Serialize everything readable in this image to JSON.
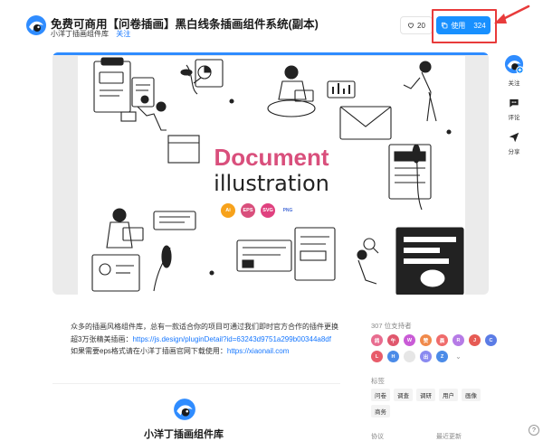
{
  "header": {
    "title": "免费可商用【问卷插画】黑白线条插画组件系统(副本)",
    "author": "小洋丁插画组件库",
    "follow_label": "关注",
    "like_count": "20",
    "use_label": "使用",
    "use_count": "324"
  },
  "preview": {
    "heading": "Document",
    "subheading": "illustration",
    "format_badges": [
      {
        "label": "Ai",
        "color": "#f7a21b"
      },
      {
        "label": "EPS",
        "color": "#d94f7c"
      },
      {
        "label": "SVG",
        "color": "#e0417f"
      },
      {
        "label": "PNG",
        "color": "#4a6fd8"
      }
    ]
  },
  "rail": {
    "follow_label": "关注",
    "comment_label": "评论",
    "share_label": "分享"
  },
  "description": {
    "line1": "众多的插画风格组件库，总有一款适合你的项目可通过我们即时官方合作的插件更换超3万张精美插画：",
    "link1": "https://js.design/pluginDetail?id=63243d9751a299b00344a8df",
    "line2": "如果需要eps格式请在小洋丁插画官网下载使用：",
    "link2": "https://xiaonail.com"
  },
  "bottom": {
    "name": "小洋丁插画组件库"
  },
  "supporters": {
    "title": "307 位支持者",
    "avatars": [
      {
        "label": "鸽",
        "color": "#e86c8f"
      },
      {
        "label": "午",
        "color": "#e0576d"
      },
      {
        "label": "W",
        "color": "#c95bd6"
      },
      {
        "label": "赞",
        "color": "#f08a4b"
      },
      {
        "label": "晨",
        "color": "#ef6b6b"
      },
      {
        "label": "R",
        "color": "#b67be6"
      },
      {
        "label": "J",
        "color": "#e65b54"
      },
      {
        "label": "C",
        "color": "#5b7ce6"
      },
      {
        "label": "L",
        "color": "#e85c6a"
      },
      {
        "label": "H",
        "color": "#4b8be8"
      },
      {
        "label": "",
        "color": "#e6e6e6"
      },
      {
        "label": "出",
        "color": "#8a8af0"
      },
      {
        "label": "Z",
        "color": "#4b8be8"
      }
    ]
  },
  "tags": {
    "title": "标签",
    "items": [
      "问卷",
      "调查",
      "调研",
      "用户",
      "画像",
      "商务"
    ]
  },
  "footer": {
    "protocol_label": "协议",
    "update_label": "最近更新"
  },
  "colors": {
    "accent": "#1890ff",
    "highlight": "#e83b3b",
    "doc_title": "#d94f7c"
  }
}
